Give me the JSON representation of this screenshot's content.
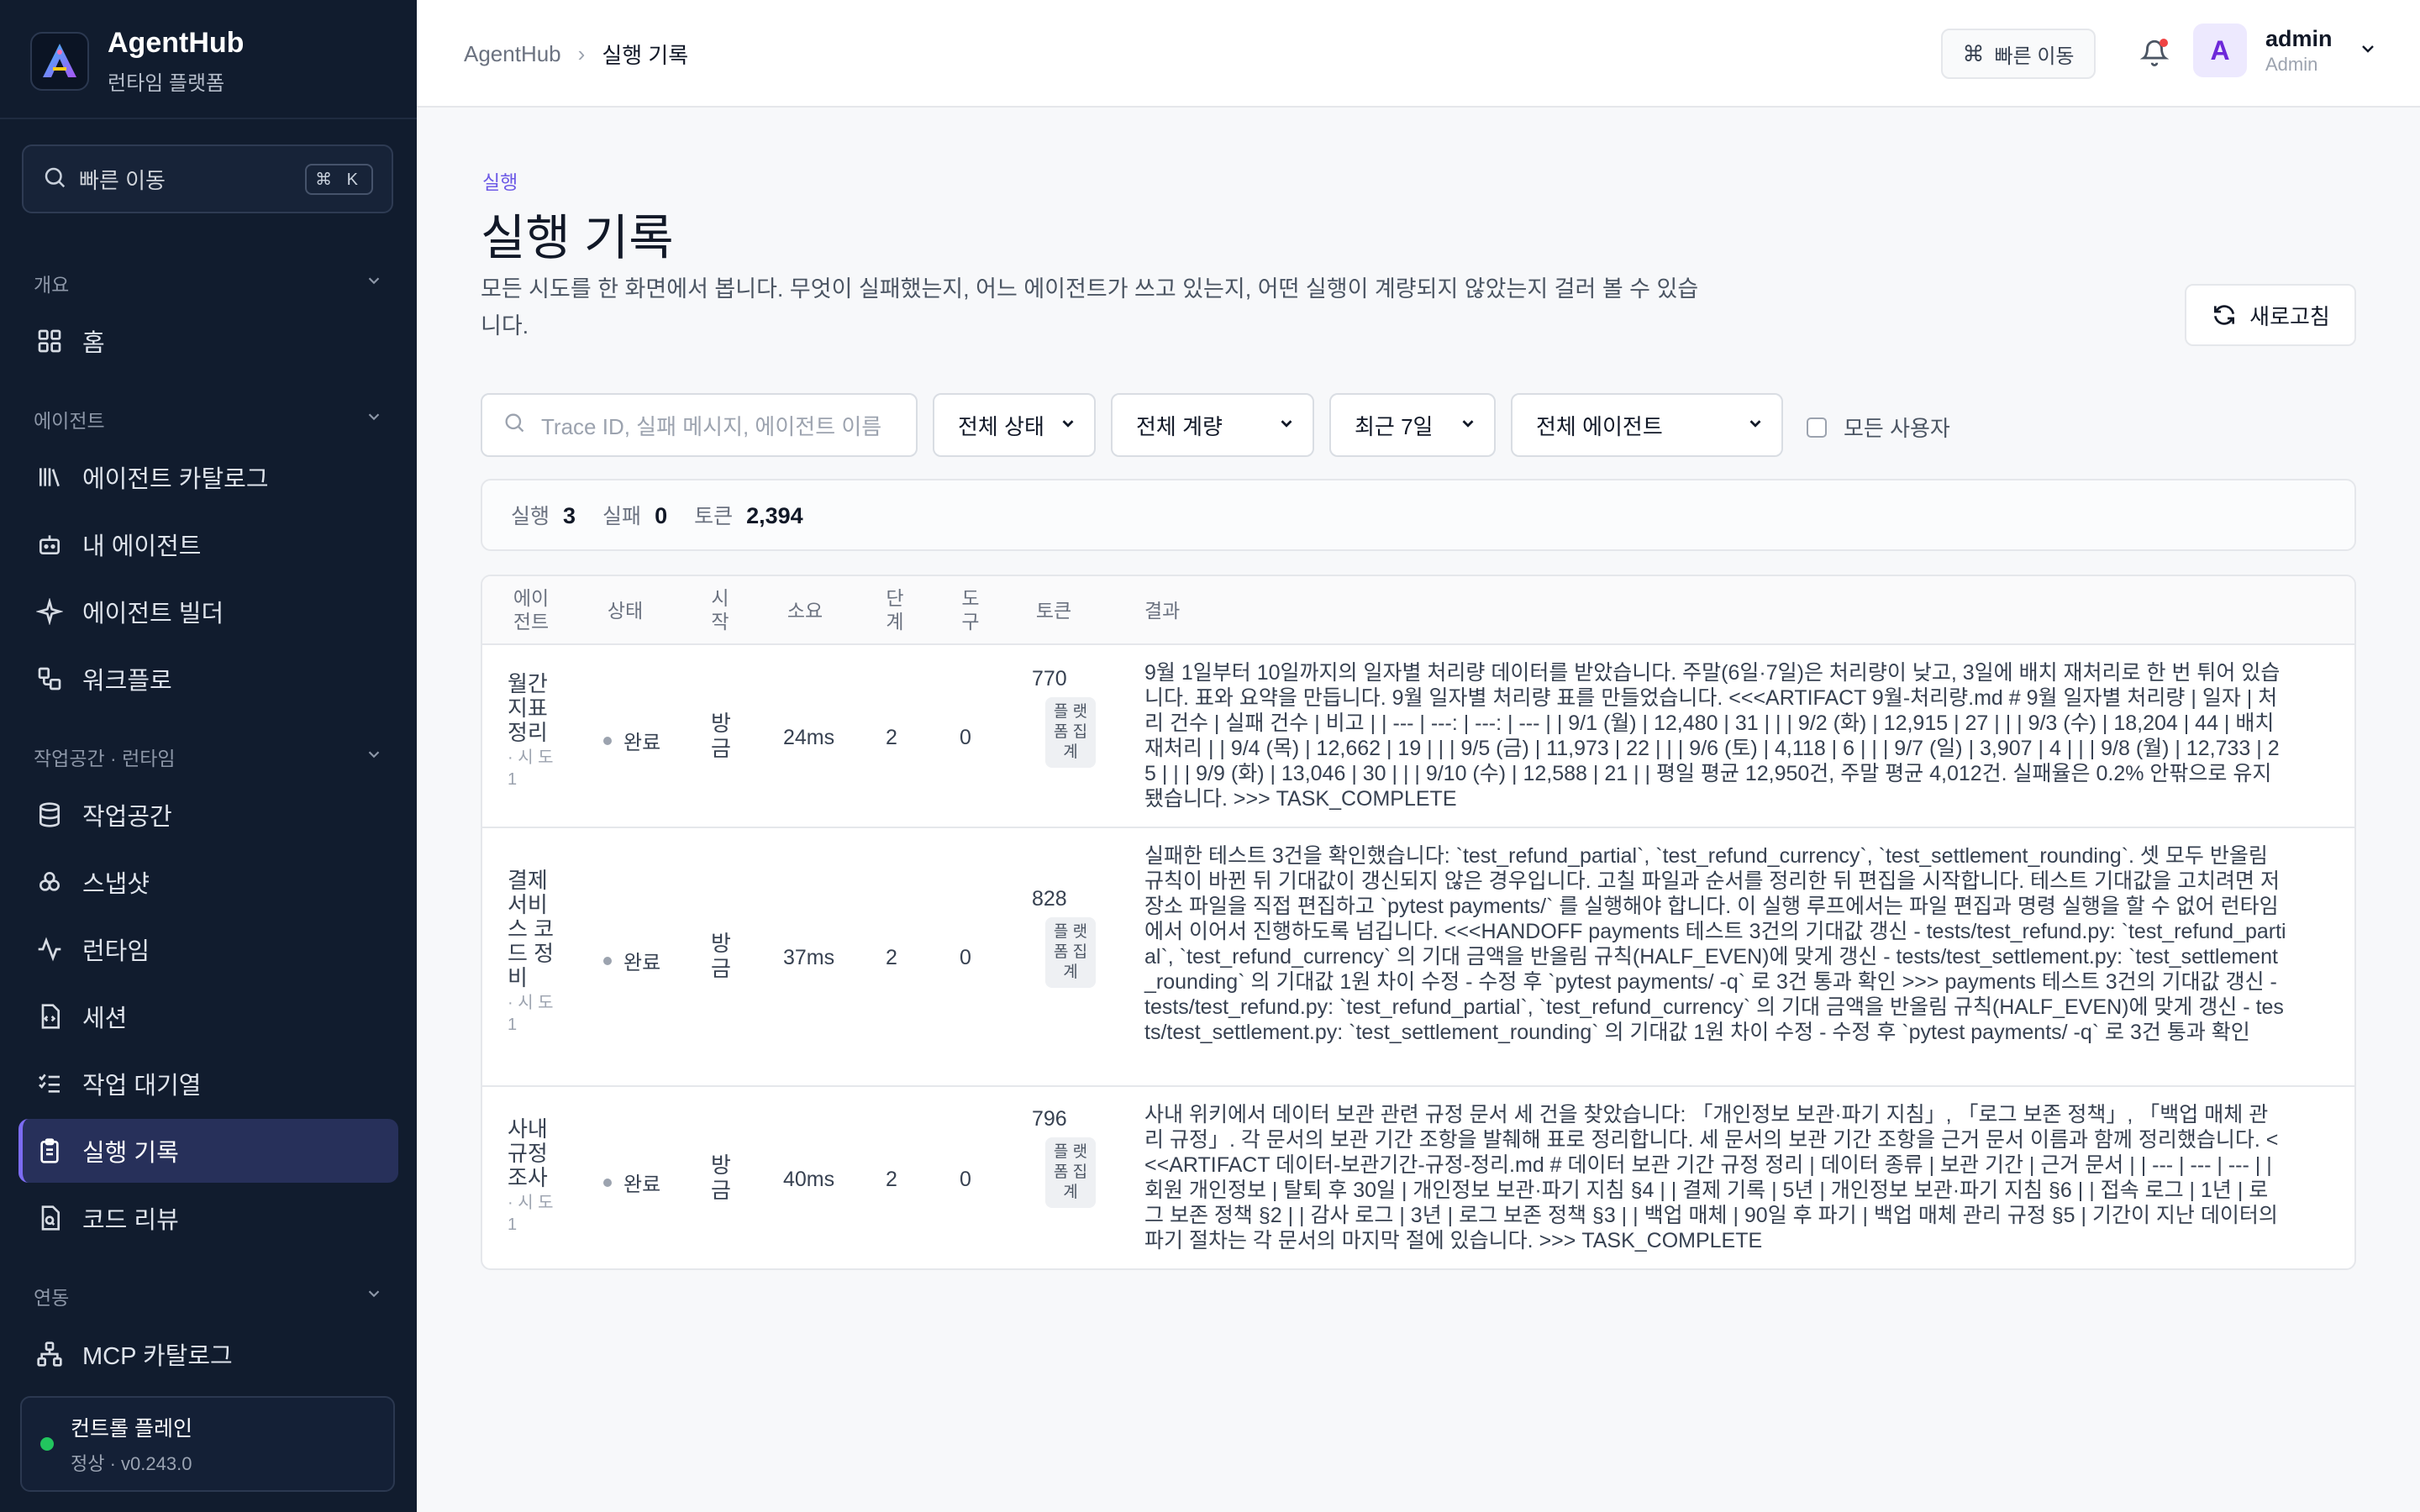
{
  "app": {
    "name": "AgentHub",
    "subtitle": "런타임 플랫폼"
  },
  "sidebar": {
    "search_label": "빠른 이동",
    "search_kbd": "⌘ K",
    "sections": {
      "overview": "개요",
      "agents": "에이전트",
      "workspace": "작업공간 · 런타임",
      "integrations": "연동"
    },
    "items": [
      {
        "label": "홈",
        "icon": "grid-icon"
      },
      {
        "label": "에이전트 카탈로그",
        "icon": "library-icon"
      },
      {
        "label": "내 에이전트",
        "icon": "bot-icon"
      },
      {
        "label": "에이전트 빌더",
        "icon": "sparkle-icon"
      },
      {
        "label": "워크플로",
        "icon": "workflow-icon"
      },
      {
        "label": "작업공간",
        "icon": "database-icon"
      },
      {
        "label": "스냅샷",
        "icon": "layers-icon"
      },
      {
        "label": "런타임",
        "icon": "activity-icon"
      },
      {
        "label": "세션",
        "icon": "file-code-icon"
      },
      {
        "label": "작업 대기열",
        "icon": "list-checks-icon"
      },
      {
        "label": "실행 기록",
        "icon": "clipboard-list-icon"
      },
      {
        "label": "코드 리뷰",
        "icon": "file-search-icon"
      },
      {
        "label": "MCP 카탈로그",
        "icon": "network-icon"
      }
    ],
    "control_plane": {
      "title": "컨트롤 플레인",
      "status": "정상 · v0.243.0",
      "status_color": "#22c55e"
    }
  },
  "header": {
    "breadcrumb_root": "AgentHub",
    "breadcrumb_current": "실행 기록",
    "quick_label": "빠른 이동",
    "quick_kbd": "⌘",
    "user": {
      "initial": "A",
      "name": "admin",
      "role": "Admin"
    }
  },
  "page": {
    "kicker": "실행",
    "title": "실행 기록",
    "description": "모든 시도를 한 화면에서 봅니다. 무엇이 실패했는지, 어느 에이전트가 쓰고 있는지, 어떤 실행이 계량되지 않았는지 걸러 볼 수 있습니다.",
    "refresh": "새로고침"
  },
  "filters": {
    "search_placeholder": "Trace ID, 실패 메시지, 에이전트 이름",
    "status": "전체 상태",
    "metering": "전체 계량",
    "period": "최근 7일",
    "agent": "전체 에이전트",
    "all_users": "모든 사용자"
  },
  "stats": {
    "runs_label": "실행",
    "runs": "3",
    "fail_label": "실패",
    "fail": "0",
    "tokens_label": "토큰",
    "tokens": "2,394"
  },
  "table": {
    "headers": {
      "agent": "에이 전트",
      "status": "상태",
      "start": "시 작",
      "duration": "소요",
      "steps": "단 계",
      "tools": "도 구",
      "tokens": "토큰",
      "result": "결과"
    },
    "rows": [
      {
        "agent": "월간 지표 정리",
        "attempt": "· 시 도 1",
        "status": "완료",
        "start": "방 금",
        "duration": "24ms",
        "steps": "2",
        "tools": "0",
        "tokens": "770",
        "metering": "플 랫 폼 집 계",
        "result": "9월 1일부터 10일까지의 일자별 처리량 데이터를 받았습니다. 주말(6일·7일)은 처리량이 낮고, 3일에 배치 재처리로 한 번 튀어 있습니다. 표와 요약을 만듭니다. 9월 일자별 처리량 표를 만들었습니다. <<<ARTIFACT 9월-처리량.md # 9월 일자별 처리량 | 일자 | 처리 건수 | 실패 건수 | 비고 | | --- | ---: | ---: | --- | | 9/1 (월) | 12,480 | 31 | | | 9/2 (화) | 12,915 | 27 | | | 9/3 (수) | 18,204 | 44 | 배치 재처리 | | 9/4 (목) | 12,662 | 19 | | | 9/5 (금) | 11,973 | 22 | | | 9/6 (토) | 4,118 | 6 | | | 9/7 (일) | 3,907 | 4 | | | 9/8 (월) | 12,733 | 25 | | | 9/9 (화) | 13,046 | 30 | | | 9/10 (수) | 12,588 | 21 | | 평일 평균 12,950건, 주말 평균 4,012건. 실패율은 0.2% 안팎으로 유지됐습니다. >>> TASK_COMPLETE"
      },
      {
        "agent": "결제 서비 스 코드 정비",
        "attempt": "· 시 도 1",
        "status": "완료",
        "start": "방 금",
        "duration": "37ms",
        "steps": "2",
        "tools": "0",
        "tokens": "828",
        "metering": "플 랫 폼 집 계",
        "result": "실패한 테스트 3건을 확인했습니다: `test_refund_partial`, `test_refund_currency`, `test_settlement_rounding`. 셋 모두 반올림 규칙이 바뀐 뒤 기대값이 갱신되지 않은 경우입니다. 고칠 파일과 순서를 정리한 뒤 편집을 시작합니다. 테스트 기대값을 고치려면 저장소 파일을 직접 편집하고 `pytest payments/` 를 실행해야 합니다. 이 실행 루프에서는 파일 편집과 명령 실행을 할 수 없어 런타임에서 이어서 진행하도록 넘깁니다. <<<HANDOFF payments 테스트 3건의 기대값 갱신 - tests/test_refund.py: `test_refund_partial`, `test_refund_currency` 의 기대 금액을 반올림 규칙(HALF_EVEN)에 맞게 갱신 - tests/test_settlement.py: `test_settlement_rounding` 의 기대값 1원 차이 수정 - 수정 후 `pytest payments/ -q` 로 3건 통과 확인 >>> payments 테스트 3건의 기대값 갱신 - tests/test_refund.py: `test_refund_partial`, `test_refund_currency` 의 기대 금액을 반올림 규칙(HALF_EVEN)에 맞게 갱신 - tests/test_settlement.py: `test_settlement_rounding` 의 기대값 1원 차이 수정 - 수정 후 `pytest payments/ -q` 로 3건 통과 확인"
      },
      {
        "agent": "사내 규정 조사",
        "attempt": "· 시 도 1",
        "status": "완료",
        "start": "방 금",
        "duration": "40ms",
        "steps": "2",
        "tools": "0",
        "tokens": "796",
        "metering": "플 랫 폼 집 계",
        "result": "사내 위키에서 데이터 보관 관련 규정 문서 세 건을 찾았습니다: 「개인정보 보관·파기 지침」, 「로그 보존 정책」, 「백업 매체 관리 규정」. 각 문서의 보관 기간 조항을 발췌해 표로 정리합니다. 세 문서의 보관 기간 조항을 근거 문서 이름과 함께 정리했습니다. <<<ARTIFACT 데이터-보관기간-규정-정리.md # 데이터 보관 기간 규정 정리 | 데이터 종류 | 보관 기간 | 근거 문서 | | --- | --- | --- | | 회원 개인정보 | 탈퇴 후 30일 | 개인정보 보관·파기 지침 §4 | | 결제 기록 | 5년 | 개인정보 보관·파기 지침 §6 | | 접속 로그 | 1년 | 로그 보존 정책 §2 | | 감사 로그 | 3년 | 로그 보존 정책 §3 | | 백업 매체 | 90일 후 파기 | 백업 매체 관리 규정 §5 | 기간이 지난 데이터의 파기 절차는 각 문서의 마지막 절에 있습니다. >>> TASK_COMPLETE"
      }
    ]
  },
  "colors": {
    "accent": "#7c6cf2",
    "sidebar_bg": "#111c2e",
    "success": "#22c55e"
  }
}
